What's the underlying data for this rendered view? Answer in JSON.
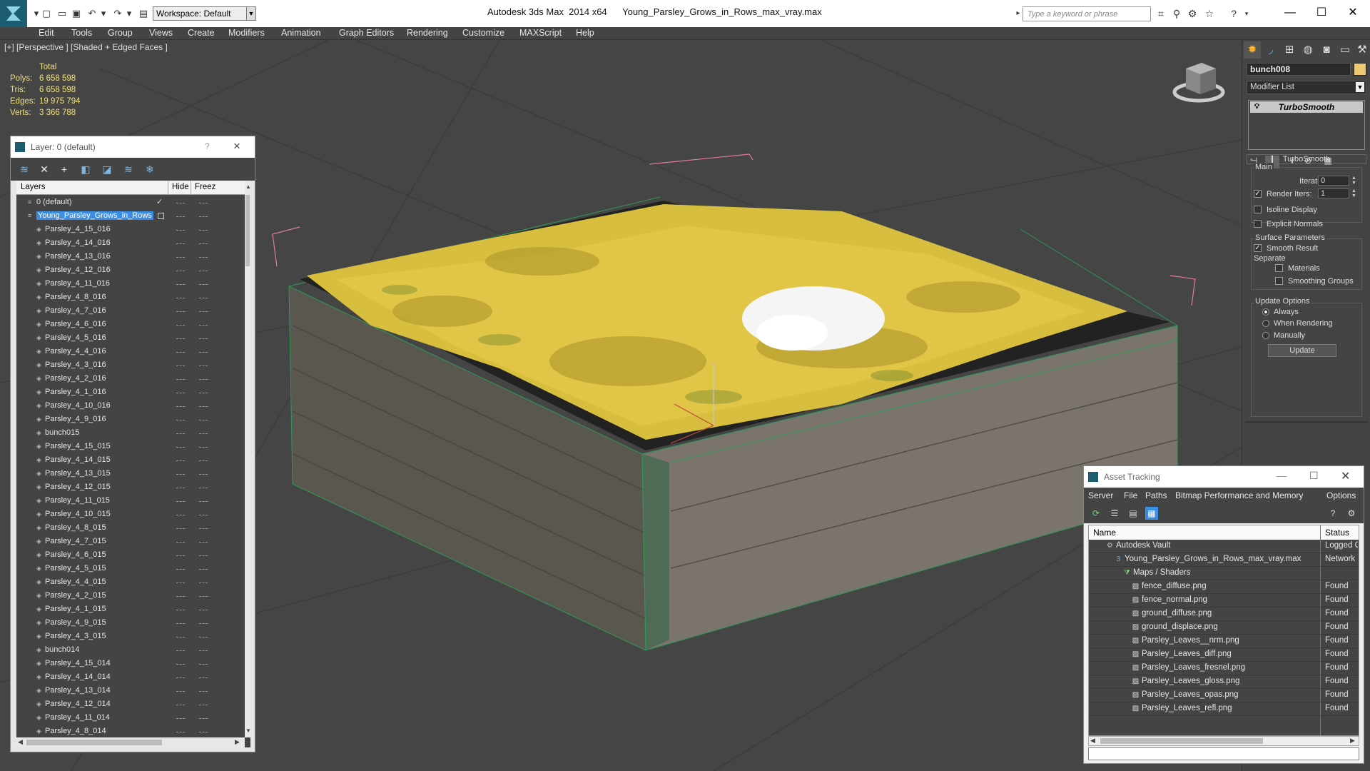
{
  "app": {
    "title": "Autodesk 3ds Max  2014 x64",
    "file": "Young_Parsley_Grows_in_Rows_max_vray.max",
    "workspace": "Workspace: Default",
    "search_placeholder": "Type a keyword or phrase"
  },
  "menu": [
    "Edit",
    "Tools",
    "Group",
    "Views",
    "Create",
    "Modifiers",
    "Animation",
    "Graph Editors",
    "Rendering",
    "Customize",
    "MAXScript",
    "Help"
  ],
  "viewport": {
    "label": "[+] [Perspective ] [Shaded + Edged Faces ]",
    "stats": {
      "header": "Total",
      "rows": [
        {
          "label": "Polys:",
          "value": "6 658 598"
        },
        {
          "label": "Tris:",
          "value": "6 658 598"
        },
        {
          "label": "Edges:",
          "value": "19 975 794"
        },
        {
          "label": "Verts:",
          "value": "3 366 788"
        }
      ]
    }
  },
  "layer_dialog": {
    "title": "Layer: 0 (default)",
    "help": "?",
    "close": "×",
    "columns": {
      "layers": "Layers",
      "hide": "Hide",
      "freeze": "Freez"
    },
    "rows": [
      {
        "name": "0 (default)",
        "indent": 1,
        "type": "layer",
        "check": "✓"
      },
      {
        "name": "Young_Parsley_Grows_in_Rows",
        "indent": 1,
        "type": "layer",
        "selected": true
      },
      {
        "name": "Parsley_4_15_016",
        "indent": 2,
        "type": "object"
      },
      {
        "name": "Parsley_4_14_016",
        "indent": 2,
        "type": "object"
      },
      {
        "name": "Parsley_4_13_016",
        "indent": 2,
        "type": "object"
      },
      {
        "name": "Parsley_4_12_016",
        "indent": 2,
        "type": "object"
      },
      {
        "name": "Parsley_4_11_016",
        "indent": 2,
        "type": "object"
      },
      {
        "name": "Parsley_4_8_016",
        "indent": 2,
        "type": "object"
      },
      {
        "name": "Parsley_4_7_016",
        "indent": 2,
        "type": "object"
      },
      {
        "name": "Parsley_4_6_016",
        "indent": 2,
        "type": "object"
      },
      {
        "name": "Parsley_4_5_016",
        "indent": 2,
        "type": "object"
      },
      {
        "name": "Parsley_4_4_016",
        "indent": 2,
        "type": "object"
      },
      {
        "name": "Parsley_4_3_016",
        "indent": 2,
        "type": "object"
      },
      {
        "name": "Parsley_4_2_016",
        "indent": 2,
        "type": "object"
      },
      {
        "name": "Parsley_4_1_016",
        "indent": 2,
        "type": "object"
      },
      {
        "name": "Parsley_4_10_016",
        "indent": 2,
        "type": "object"
      },
      {
        "name": "Parsley_4_9_016",
        "indent": 2,
        "type": "object"
      },
      {
        "name": "bunch015",
        "indent": 2,
        "type": "object"
      },
      {
        "name": "Parsley_4_15_015",
        "indent": 2,
        "type": "object"
      },
      {
        "name": "Parsley_4_14_015",
        "indent": 2,
        "type": "object"
      },
      {
        "name": "Parsley_4_13_015",
        "indent": 2,
        "type": "object"
      },
      {
        "name": "Parsley_4_12_015",
        "indent": 2,
        "type": "object"
      },
      {
        "name": "Parsley_4_11_015",
        "indent": 2,
        "type": "object"
      },
      {
        "name": "Parsley_4_10_015",
        "indent": 2,
        "type": "object"
      },
      {
        "name": "Parsley_4_8_015",
        "indent": 2,
        "type": "object"
      },
      {
        "name": "Parsley_4_7_015",
        "indent": 2,
        "type": "object"
      },
      {
        "name": "Parsley_4_6_015",
        "indent": 2,
        "type": "object"
      },
      {
        "name": "Parsley_4_5_015",
        "indent": 2,
        "type": "object"
      },
      {
        "name": "Parsley_4_4_015",
        "indent": 2,
        "type": "object"
      },
      {
        "name": "Parsley_4_2_015",
        "indent": 2,
        "type": "object"
      },
      {
        "name": "Parsley_4_1_015",
        "indent": 2,
        "type": "object"
      },
      {
        "name": "Parsley_4_9_015",
        "indent": 2,
        "type": "object"
      },
      {
        "name": "Parsley_4_3_015",
        "indent": 2,
        "type": "object"
      },
      {
        "name": "bunch014",
        "indent": 2,
        "type": "object"
      },
      {
        "name": "Parsley_4_15_014",
        "indent": 2,
        "type": "object"
      },
      {
        "name": "Parsley_4_14_014",
        "indent": 2,
        "type": "object"
      },
      {
        "name": "Parsley_4_13_014",
        "indent": 2,
        "type": "object"
      },
      {
        "name": "Parsley_4_12_014",
        "indent": 2,
        "type": "object"
      },
      {
        "name": "Parsley_4_11_014",
        "indent": 2,
        "type": "object"
      },
      {
        "name": "Parsley_4_8_014",
        "indent": 2,
        "type": "object"
      }
    ]
  },
  "command_panel": {
    "object_name": "bunch008",
    "object_color": "#f0c870",
    "modifier_list": "Modifier List",
    "stack_item": "TurboSmooth",
    "rollout_title": "TurboSmooth",
    "main_group": "Main",
    "iterations_label": "Iterations:",
    "iterations_value": "0",
    "render_iters_label": "Render Iters:",
    "render_iters_value": "1",
    "isoline_display": "Isoline Display",
    "explicit_normals": "Explicit Normals",
    "surface_group": "Surface Parameters",
    "smooth_result": "Smooth Result",
    "separate_label": "Separate",
    "materials": "Materials",
    "smoothing_groups": "Smoothing Groups",
    "update_group": "Update Options",
    "always": "Always",
    "when_rendering": "When Rendering",
    "manually": "Manually",
    "update_button": "Update"
  },
  "asset_dialog": {
    "title": "Asset Tracking",
    "menu": [
      "Server",
      "File",
      "Paths",
      "Bitmap Performance and Memory",
      "Options"
    ],
    "columns": {
      "name": "Name",
      "status": "Status"
    },
    "rows": [
      {
        "name": "Autodesk Vault",
        "indent": 1,
        "icon": "vault",
        "status": "Logged Out"
      },
      {
        "name": "Young_Parsley_Grows_in_Rows_max_vray.max",
        "indent": 2,
        "icon": "max",
        "status": "Network Path"
      },
      {
        "name": "Maps / Shaders",
        "indent": 3,
        "icon": "maps",
        "status": ""
      },
      {
        "name": "fence_diffuse.png",
        "indent": 4,
        "icon": "file",
        "status": "Found"
      },
      {
        "name": "fence_normal.png",
        "indent": 4,
        "icon": "file",
        "status": "Found"
      },
      {
        "name": "ground_diffuse.png",
        "indent": 4,
        "icon": "file",
        "status": "Found"
      },
      {
        "name": "ground_displace.png",
        "indent": 4,
        "icon": "file",
        "status": "Found"
      },
      {
        "name": "Parsley_Leaves__nrm.png",
        "indent": 4,
        "icon": "file",
        "status": "Found"
      },
      {
        "name": "Parsley_Leaves_diff.png",
        "indent": 4,
        "icon": "file",
        "status": "Found"
      },
      {
        "name": "Parsley_Leaves_fresnel.png",
        "indent": 4,
        "icon": "file",
        "status": "Found"
      },
      {
        "name": "Parsley_Leaves_gloss.png",
        "indent": 4,
        "icon": "file",
        "status": "Found"
      },
      {
        "name": "Parsley_Leaves_opas.png",
        "indent": 4,
        "icon": "file",
        "status": "Found"
      },
      {
        "name": "Parsley_Leaves_refl.png",
        "indent": 4,
        "icon": "file",
        "status": "Found"
      }
    ]
  }
}
